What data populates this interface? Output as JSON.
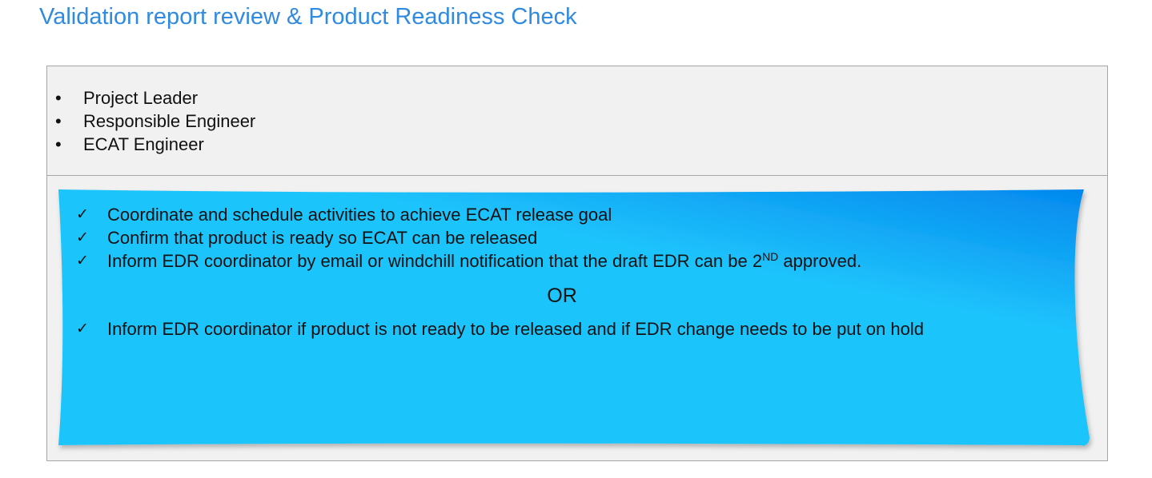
{
  "title": "Validation report review & Product Readiness Check",
  "roles": {
    "bullet": "•",
    "items": [
      "Project Leader",
      "Responsible Engineer",
      "ECAT Engineer"
    ]
  },
  "tasks": {
    "check": "✓",
    "items": [
      "Coordinate and schedule activities to achieve ECAT release goal",
      "Confirm that product is ready so ECAT can be released"
    ],
    "inform_prefix": "Inform EDR coordinator by email or windchill notification that the draft EDR  can be 2",
    "inform_sup": "ND",
    "inform_suffix": " approved.",
    "or_label": "OR",
    "hold_item": "Inform EDR coordinator if product is not ready to be released and if EDR change needs to be put on hold"
  },
  "colors": {
    "title": "#2f8ae0",
    "note_gradient_start": "#1fc4fc",
    "note_gradient_end": "#0388ee",
    "frame_border": "#a6a6a6",
    "frame_fill": "#f1f1f1"
  }
}
